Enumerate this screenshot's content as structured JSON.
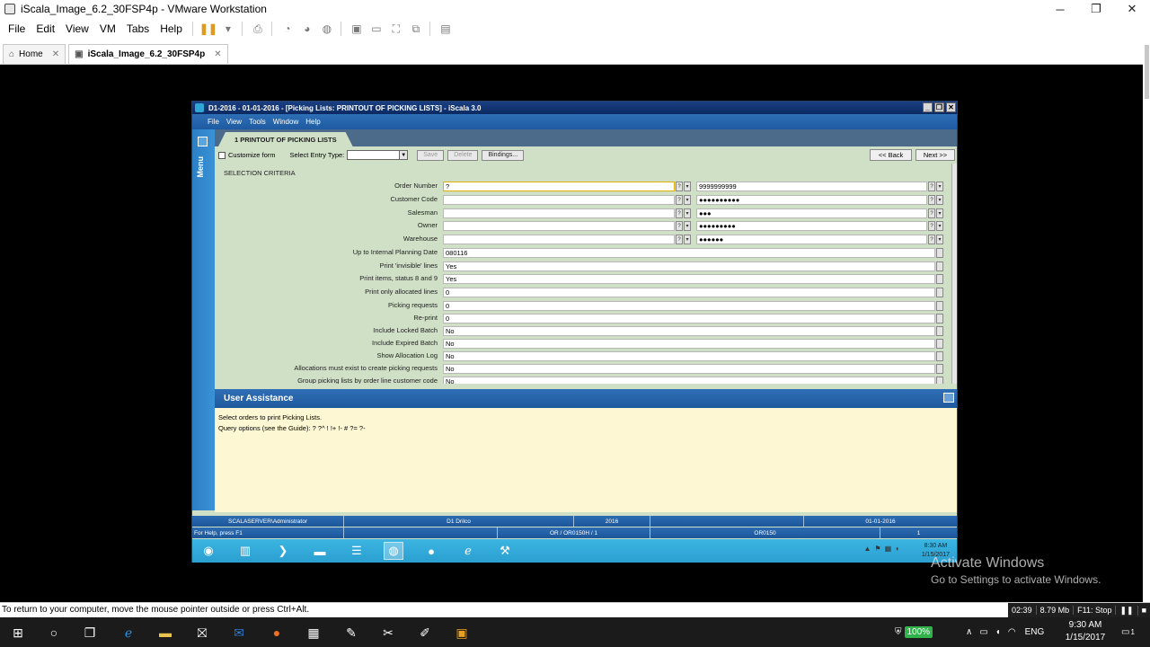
{
  "vm": {
    "title": "iScala_Image_6.2_30FSP4p - VMware Workstation",
    "menu": [
      "File",
      "Edit",
      "View",
      "VM",
      "Tabs",
      "Help"
    ],
    "tabs": [
      {
        "label": "Home"
      },
      {
        "label": "iScala_Image_6.2_30FSP4p"
      }
    ],
    "status_hint": "To return to your computer, move the mouse pointer outside or press Ctrl+Alt.",
    "status_right": [
      "02:39",
      "8.79 Mb",
      "F11: Stop"
    ]
  },
  "activate": {
    "line1": "Activate Windows",
    "line2": "Go to Settings to activate Windows."
  },
  "host": {
    "battery": "100%",
    "lang": "ENG",
    "time": "9:30 AM",
    "date": "1/15/2017",
    "notif_count": "1"
  },
  "iscala": {
    "title": "D1-2016 - 01-01-2016 - [Picking Lists: PRINTOUT OF PICKING LISTS] - iScala 3.0",
    "menu": [
      "File",
      "View",
      "Tools",
      "Window",
      "Help"
    ],
    "side_label": "Menu",
    "tab_label": "1 PRINTOUT OF PICKING LISTS",
    "toolbar": {
      "customize": "Customize form",
      "entry_type_label": "Select Entry Type:",
      "save": "Save",
      "delete": "Delete",
      "bindings": "Bindings...",
      "back": "<< Back",
      "next": "Next >>"
    },
    "section": "SELECTION CRITERIA",
    "range_rows": [
      {
        "label": "Order Number",
        "from": "?",
        "to": "9999999999"
      },
      {
        "label": "Customer Code",
        "from": "",
        "to": "●●●●●●●●●●"
      },
      {
        "label": "Salesman",
        "from": "",
        "to": "●●●"
      },
      {
        "label": "Owner",
        "from": "",
        "to": "●●●●●●●●●"
      },
      {
        "label": "Warehouse",
        "from": "",
        "to": "●●●●●●"
      }
    ],
    "single_rows": [
      {
        "label": "Up to Internal Planning Date",
        "value": "080116"
      },
      {
        "label": "Print 'invisible' lines",
        "value": "Yes"
      },
      {
        "label": "Print items, status 8 and 9",
        "value": "Yes"
      },
      {
        "label": "Print only allocated lines",
        "value": "0"
      },
      {
        "label": "Picking requests",
        "value": "0"
      },
      {
        "label": "Re-print",
        "value": "0"
      },
      {
        "label": "Include Locked Batch",
        "value": "No"
      },
      {
        "label": "Include Expired Batch",
        "value": "No"
      },
      {
        "label": "Show Allocation Log",
        "value": "No"
      },
      {
        "label": "Allocations must exist to create picking requests",
        "value": "No"
      },
      {
        "label": "Group picking lists by order line customer code",
        "value": "No"
      }
    ],
    "user_assistance": {
      "title": "User Assistance",
      "line1": "Select orders to print Picking Lists.",
      "line2": "Query options (see the Guide):  ?  ?^  !  !+  !-  #  ?=  ?-"
    },
    "status1": [
      "SCALASERVER\\Administrator",
      "D1 Drilco",
      "2016",
      "",
      "01-01-2016"
    ],
    "status2": [
      "For Help, press F1",
      "",
      "OR / OR0150H / 1",
      "OR0150",
      "",
      "1"
    ],
    "guest_time": "8:30 AM",
    "guest_date": "1/15/2017"
  }
}
